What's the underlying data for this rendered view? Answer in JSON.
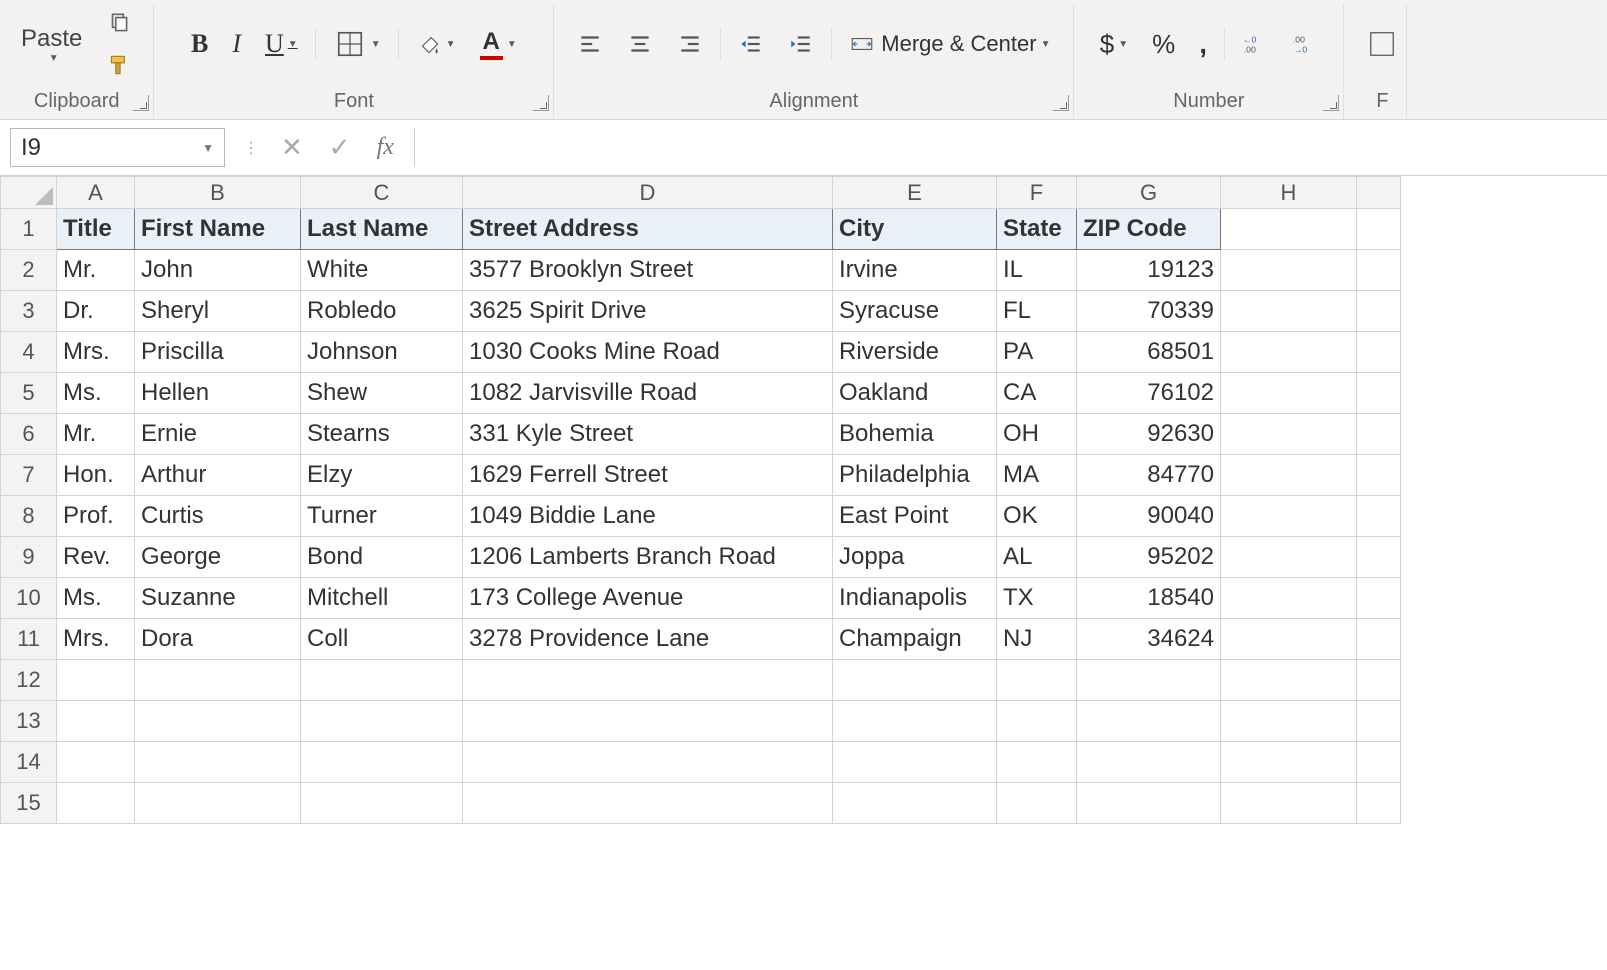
{
  "ribbon": {
    "clipboard": {
      "paste": "Paste",
      "label": "Clipboard"
    },
    "font": {
      "bold": "B",
      "italic": "I",
      "underline": "U",
      "label": "Font"
    },
    "alignment": {
      "merge": "Merge & Center",
      "label": "Alignment"
    },
    "number": {
      "dollar": "$",
      "percent": "%",
      "comma": ",",
      "label": "Number"
    },
    "format_partial": "F"
  },
  "formula_bar": {
    "name_box": "I9",
    "fx": "fx",
    "value": ""
  },
  "grid": {
    "columns": [
      "A",
      "B",
      "C",
      "D",
      "E",
      "F",
      "G",
      "H"
    ],
    "total_rows": 15,
    "headers": [
      "Title",
      "First Name",
      "Last Name",
      "Street Address",
      "City",
      "State",
      "ZIP Code"
    ],
    "rows": [
      [
        "Mr.",
        "John",
        "White",
        "3577 Brooklyn Street",
        "Irvine",
        "IL",
        "19123"
      ],
      [
        "Dr.",
        "Sheryl",
        "Robledo",
        "3625 Spirit Drive",
        "Syracuse",
        "FL",
        "70339"
      ],
      [
        "Mrs.",
        "Priscilla",
        "Johnson",
        "1030 Cooks Mine Road",
        "Riverside",
        "PA",
        "68501"
      ],
      [
        "Ms.",
        "Hellen",
        "Shew",
        "1082 Jarvisville Road",
        "Oakland",
        "CA",
        "76102"
      ],
      [
        "Mr.",
        "Ernie",
        "Stearns",
        "331 Kyle Street",
        "Bohemia",
        "OH",
        "92630"
      ],
      [
        "Hon.",
        "Arthur",
        "Elzy",
        "1629 Ferrell Street",
        "Philadelphia",
        "MA",
        "84770"
      ],
      [
        "Prof.",
        "Curtis",
        "Turner",
        "1049 Biddie Lane",
        "East Point",
        "OK",
        "90040"
      ],
      [
        "Rev.",
        "George",
        "Bond",
        "1206 Lamberts Branch Road",
        "Joppa",
        "AL",
        "95202"
      ],
      [
        "Ms.",
        "Suzanne",
        "Mitchell",
        "173 College Avenue",
        "Indianapolis",
        "TX",
        "18540"
      ],
      [
        "Mrs.",
        "Dora",
        "Coll",
        "3278 Providence Lane",
        "Champaign",
        "NJ",
        "34624"
      ]
    ]
  }
}
